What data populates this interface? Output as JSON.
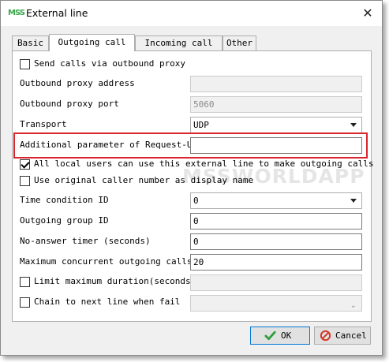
{
  "window": {
    "title": "External line",
    "app_icon_text": "MSS"
  },
  "tabs": [
    {
      "label": "Basic",
      "active": false
    },
    {
      "label": "Outgoing call",
      "active": true
    },
    {
      "label": "Incoming call",
      "active": false
    },
    {
      "label": "Other",
      "active": false
    }
  ],
  "form": {
    "send_via_proxy": {
      "label": "Send calls via outbound proxy",
      "checked": false
    },
    "proxy_address": {
      "label": "Outbound proxy address",
      "value": ""
    },
    "proxy_port": {
      "label": "Outbound proxy port",
      "value": "5060"
    },
    "transport": {
      "label": "Transport",
      "value": "UDP"
    },
    "request_uri_param": {
      "label": "Additional parameter of Request-URI",
      "value": ""
    },
    "all_local_users": {
      "label": "All local users can use this external line to make outgoing calls",
      "checked": true
    },
    "use_original_caller": {
      "label": "Use original caller number as display name",
      "checked": false
    },
    "time_condition_id": {
      "label": "Time condition ID",
      "value": "0"
    },
    "outgoing_group_id": {
      "label": "Outgoing group ID",
      "value": "0"
    },
    "no_answer_timer": {
      "label": "No-answer timer (seconds)",
      "value": "0"
    },
    "max_concurrent": {
      "label": "Maximum concurrent outgoing calls",
      "value": "20"
    },
    "limit_duration": {
      "label": "Limit maximum duration(seconds)",
      "checked": false,
      "value": ""
    },
    "chain_next_line": {
      "label": "Chain to next line when fail",
      "checked": false,
      "value": ""
    }
  },
  "watermark": "MSSWORLDAPP",
  "buttons": {
    "ok": "OK",
    "cancel": "Cancel"
  },
  "colors": {
    "highlight": "#d8262e",
    "ok_check": "#2e9e3a",
    "cancel_icon": "#d23b2b"
  }
}
